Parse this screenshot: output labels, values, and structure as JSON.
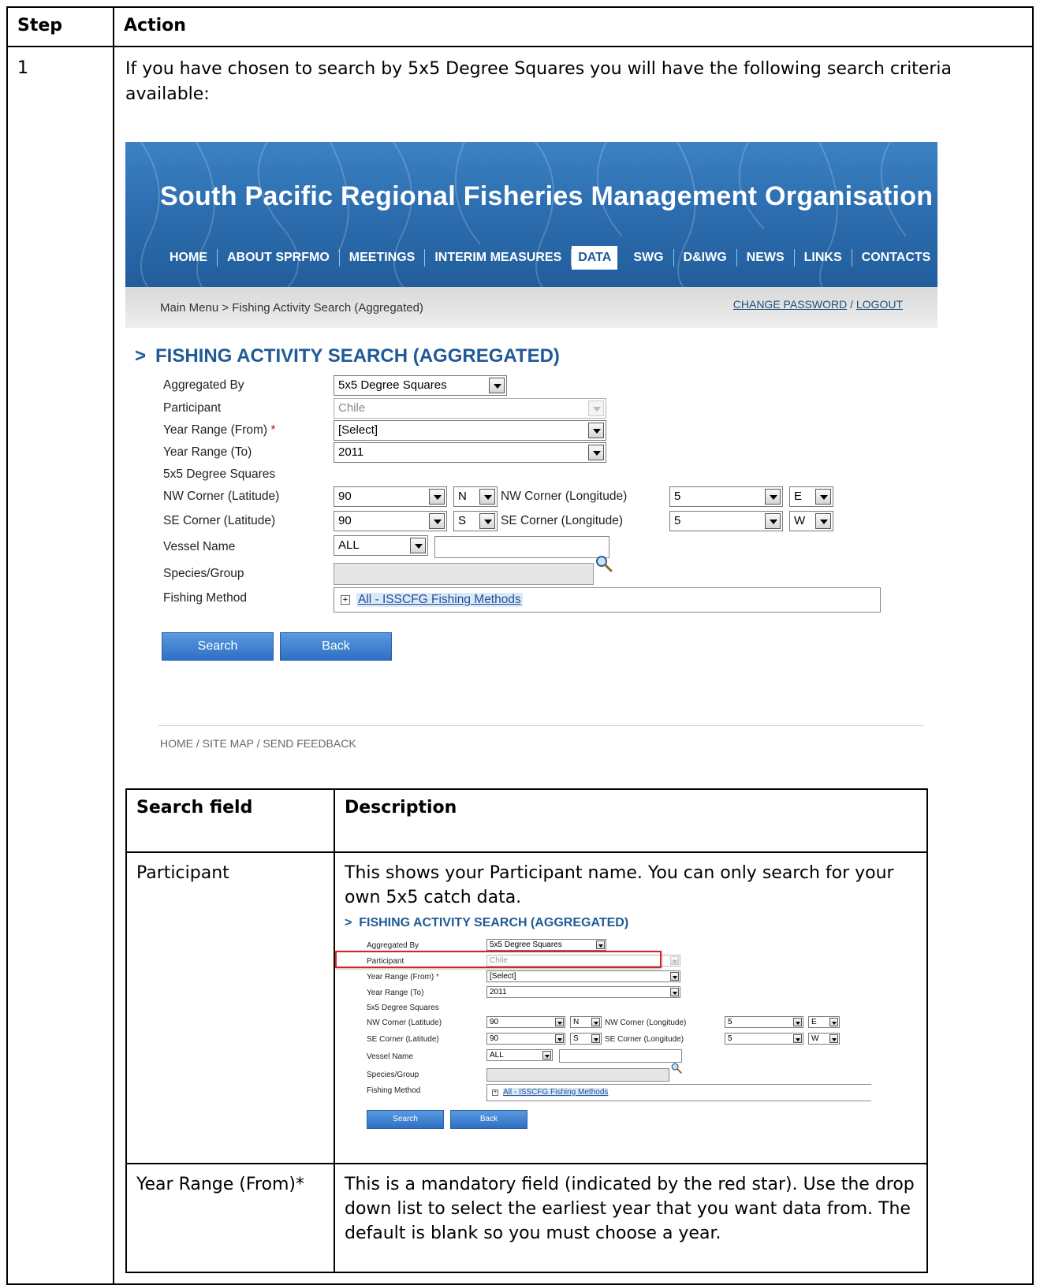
{
  "headers": {
    "step": "Step",
    "action": "Action"
  },
  "step_number": "1",
  "intro": "If you have chosen to search by 5x5 Degree Squares you will have the following search criteria available:",
  "site": {
    "title": "South Pacific Regional Fisheries Management Organisation",
    "nav": [
      "HOME",
      "ABOUT SPRFMO",
      "MEETINGS",
      "INTERIM MEASURES",
      "DATA",
      "SWG",
      "D&IWG",
      "NEWS",
      "LINKS",
      "CONTACTS"
    ],
    "active_nav": "DATA",
    "breadcrumb": "Main Menu > Fishing Activity Search (Aggregated)",
    "change_password": "CHANGE PASSWORD",
    "sep": "/",
    "logout": "LOGOUT",
    "heading": "FISHING ACTIVITY SEARCH (AGGREGATED)",
    "chevron": ">",
    "form": {
      "aggregated_by_label": "Aggregated By",
      "aggregated_by_value": "5x5 Degree Squares",
      "participant_label": "Participant",
      "participant_value": "Chile",
      "year_from_label": "Year Range (From)",
      "required_mark": "*",
      "year_from_value": "[Select]",
      "year_to_label": "Year Range (To)",
      "year_to_value": "2011",
      "squares_label": "5x5 Degree Squares",
      "nw_lat_label": "NW Corner (Latitude)",
      "nw_lat_value": "90",
      "nw_lat_dir": "N",
      "nw_lon_label": "NW Corner (Longitude)",
      "nw_lon_value": "5",
      "nw_lon_dir": "E",
      "se_lat_label": "SE Corner (Latitude)",
      "se_lat_value": "90",
      "se_lat_dir": "S",
      "se_lon_label": "SE Corner (Longitude)",
      "se_lon_value": "5",
      "se_lon_dir": "W",
      "vessel_label": "Vessel Name",
      "vessel_value": "ALL",
      "species_label": "Species/Group",
      "method_label": "Fishing Method",
      "method_expand": "+",
      "method_value": "All - ISSCFG Fishing Methods",
      "search_button": "Search",
      "back_button": "Back"
    },
    "footer": "HOME / SITE MAP / SEND FEEDBACK"
  },
  "inner_table": {
    "headers": {
      "field": "Search field",
      "description": "Description"
    },
    "rows": [
      {
        "field": "Participant",
        "description": "This shows your Participant name. You can only search for your own 5x5 catch data."
      },
      {
        "field": "Year Range (From)*",
        "description": "This is a mandatory field (indicated by the red star). Use the drop down list to select the earliest year that you want data from. The default is blank so you must choose a year."
      }
    ]
  }
}
